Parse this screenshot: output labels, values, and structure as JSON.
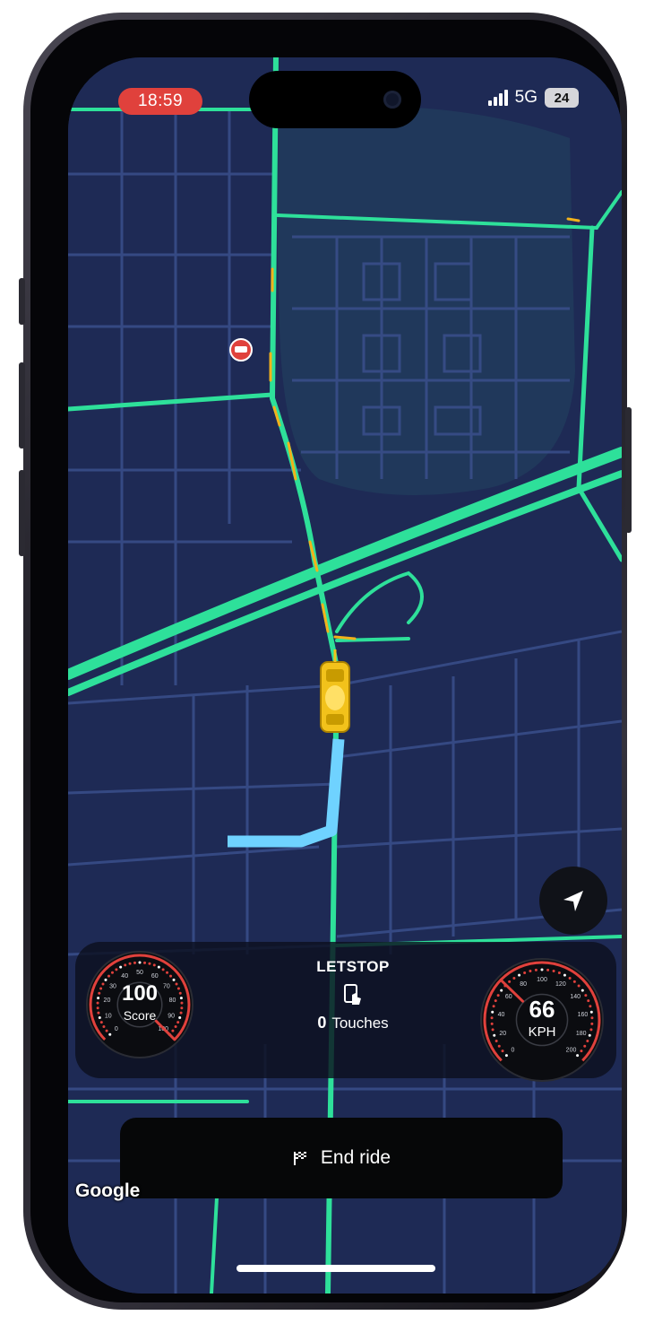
{
  "status_bar": {
    "time": "18:59",
    "network": "5G",
    "battery": "24"
  },
  "map": {
    "attribution": "Google"
  },
  "dashboard": {
    "brand": "LETSTOP",
    "score": {
      "value": "100",
      "label": "Score",
      "ticks": [
        "0",
        "10",
        "20",
        "30",
        "40",
        "50",
        "60",
        "70",
        "80",
        "90",
        "100"
      ],
      "level": 1.0
    },
    "touches": {
      "count": "0",
      "label": "Touches"
    },
    "speed": {
      "value": "66",
      "unit": "KPH",
      "ticks": [
        "0",
        "20",
        "40",
        "60",
        "80",
        "100",
        "120",
        "140",
        "160",
        "180",
        "200"
      ],
      "level": 0.33
    }
  },
  "actions": {
    "end_ride_label": "End ride"
  },
  "icons": {
    "navigation": "location-arrow-icon",
    "end_ride": "checkered-flag-icon",
    "touch": "phone-touch-icon",
    "poi": "car-service-pin-icon",
    "vehicle": "yellow-car-icon"
  },
  "colors": {
    "map_background": "#1e2a55",
    "traffic_green": "#2ee09a",
    "traffic_yellow": "#f2b21b",
    "route_blue": "#6fd2ff",
    "gauge_red": "#e0413c",
    "status_pill": "#e0413c"
  }
}
